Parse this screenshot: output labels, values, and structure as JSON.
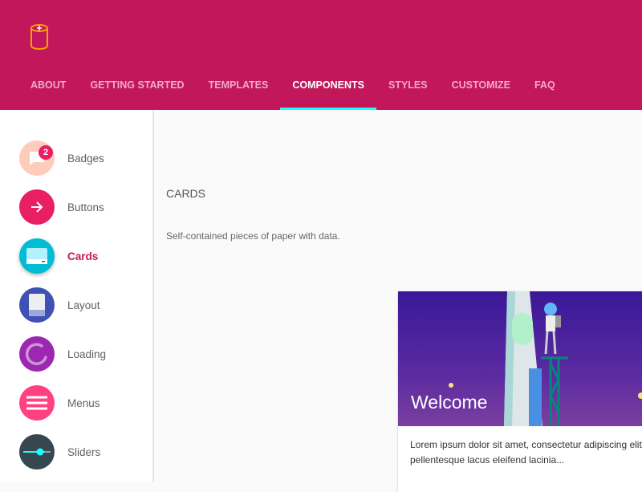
{
  "colors": {
    "primary": "#c2185b",
    "indicator": "#18ffff"
  },
  "header": {
    "logo_icon": "battery-cylinder-icon"
  },
  "nav": [
    {
      "label": "ABOUT"
    },
    {
      "label": "GETTING STARTED"
    },
    {
      "label": "TEMPLATES"
    },
    {
      "label": "COMPONENTS",
      "active": true
    },
    {
      "label": "STYLES"
    },
    {
      "label": "CUSTOMIZE"
    },
    {
      "label": "FAQ"
    }
  ],
  "sidebar": {
    "items": [
      {
        "label": "Badges",
        "badge": "2"
      },
      {
        "label": "Buttons"
      },
      {
        "label": "Cards",
        "active": true
      },
      {
        "label": "Layout"
      },
      {
        "label": "Loading"
      },
      {
        "label": "Menus"
      },
      {
        "label": "Sliders"
      }
    ]
  },
  "main": {
    "title": "CARDS",
    "description": "Self-contained pieces of paper with data.",
    "card": {
      "title": "Welcome",
      "text_line1": "Lorem ipsum dolor sit amet, consectetur adipiscing elit,",
      "text_line2": "pellentesque lacus eleifend lacinia..."
    }
  }
}
